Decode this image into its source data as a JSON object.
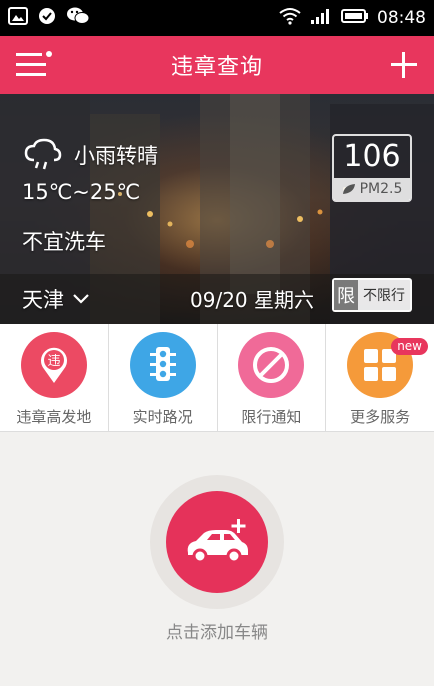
{
  "status_bar": {
    "time": "08:48"
  },
  "app_bar": {
    "title": "违章查询"
  },
  "hero": {
    "weather": "小雨转晴",
    "temperature": "15℃~25℃",
    "wash_advice": "不宜洗车",
    "city": "天津",
    "date": "09/20 星期六",
    "pm_value": "106",
    "pm_label": "PM2.5",
    "limit_mark": "限",
    "limit_text": "不限行"
  },
  "services": [
    {
      "label": "违章高发地",
      "icon": "location-pin-icon",
      "color": "#ec4a63",
      "glyph": "违"
    },
    {
      "label": "实时路况",
      "icon": "traffic-light-icon",
      "color": "#3ea6e6"
    },
    {
      "label": "限行通知",
      "icon": "no-entry-icon",
      "color": "#f06a98"
    },
    {
      "label": "更多服务",
      "icon": "grid-icon",
      "color": "#f59a3a",
      "badge": "new"
    }
  ],
  "add_vehicle": {
    "label": "点击添加车辆"
  }
}
